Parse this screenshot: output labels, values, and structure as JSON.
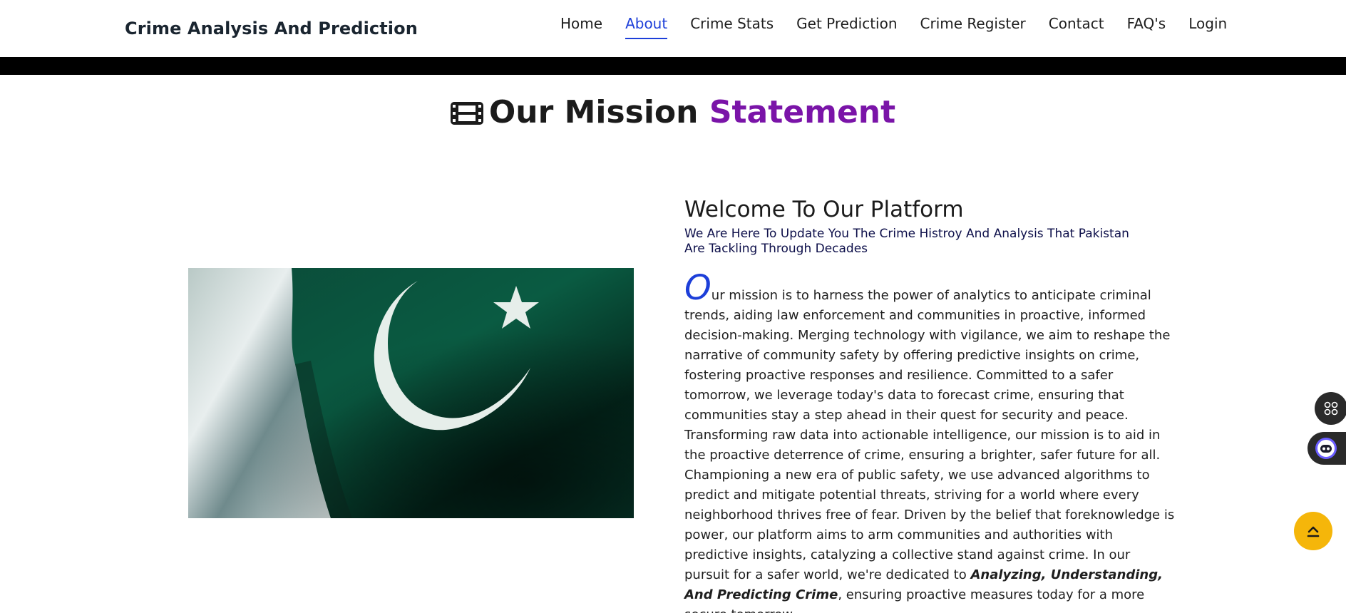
{
  "navbar": {
    "brand": "Crime Analysis And Prediction",
    "links": [
      {
        "label": "Home",
        "active": false
      },
      {
        "label": "About",
        "active": true
      },
      {
        "label": "Crime Stats",
        "active": false
      },
      {
        "label": "Get Prediction",
        "active": false
      },
      {
        "label": "Crime Register",
        "active": false
      },
      {
        "label": "Contact",
        "active": false
      },
      {
        "label": "FAQ's",
        "active": false
      },
      {
        "label": "Login",
        "active": false
      }
    ],
    "active_color": "#1d3fd9"
  },
  "mission": {
    "heading_main": "Our Mission",
    "heading_accent": "Statement",
    "accent_color": "#7a14a8",
    "icon": "film-icon"
  },
  "image": {
    "subject": "Pakistan flag",
    "colors": {
      "green": "#01411c",
      "white": "#ffffff"
    }
  },
  "content": {
    "title": "Welcome To Our Platform",
    "subtitle": "We Are Here To Update You The Crime Histroy And Analysis That Pakistan Are Tackling Through Decades",
    "dropcap": "O",
    "body_part1": "ur mission is to harness the power of analytics to anticipate criminal trends, aiding law enforcement and communities in proactive, informed decision-making. Merging technology with vigilance, we aim to reshape the narrative of community safety by offering predictive insights on crime, fostering proactive responses and resilience. Committed to a safer tomorrow, we leverage today's data to forecast crime, ensuring that communities stay a step ahead in their quest for security and peace. Transforming raw data into actionable intelligence, our mission is to aid in the proactive deterrence of crime, ensuring a brighter, safer future for all. Championing a new era of public safety, we use advanced algorithms to predict and mitigate potential threats, striving for a world where every neighborhood thrives free of fear. Driven by the belief that foreknowledge is power, our platform aims to arm communities and authorities with predictive insights, catalyzing a collective stand against crime. In our pursuit for a safer world, we're dedicated to ",
    "body_emphasis": "Analyzing, Understanding, And Predicting Crime",
    "body_part2": ", ensuring proactive measures today for a more secure tomorrow."
  },
  "floating": {
    "apps_icon": "apps-grid-icon",
    "bot_icon": "chatbot-icon",
    "top_icon": "chevron-up-icon",
    "top_color": "#f5b60a"
  }
}
